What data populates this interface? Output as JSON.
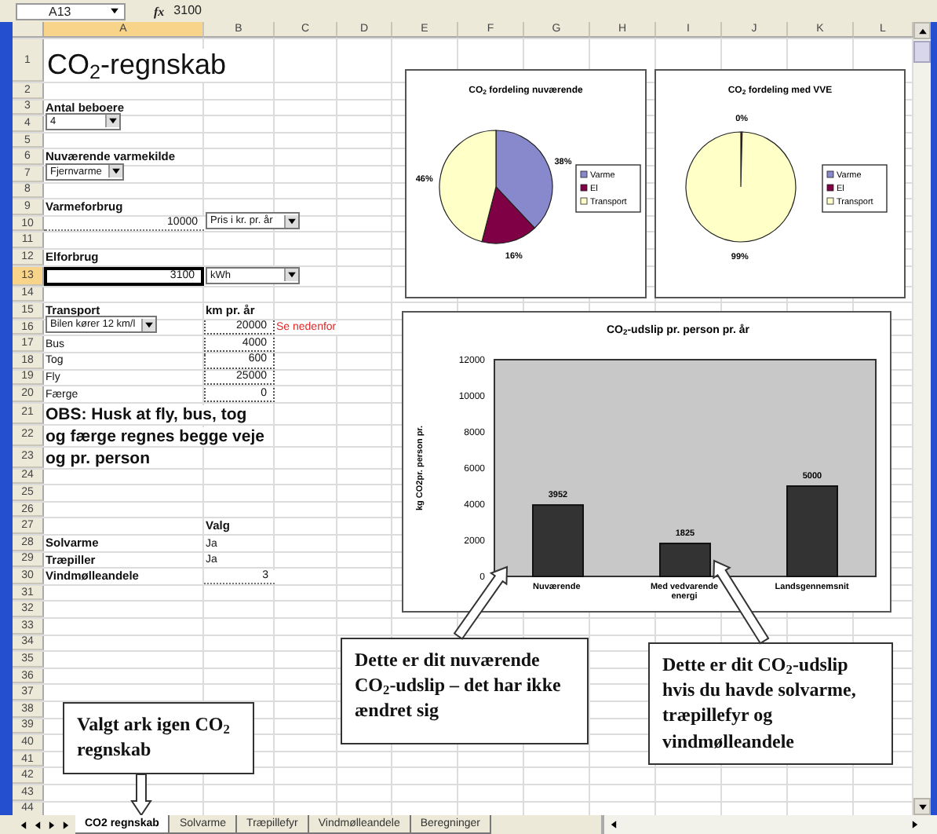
{
  "formula_bar": {
    "name_box": "A13",
    "function_label": "fx",
    "formula": "3100"
  },
  "columns": [
    "A",
    "B",
    "C",
    "D",
    "E",
    "F",
    "G",
    "H",
    "I",
    "J",
    "K",
    "L"
  ],
  "rows": [
    {
      "number": "1",
      "col_a": {
        "text": "CO$_{2}$-regnskab",
        "kind": "title",
        "selected": false
      }
    },
    {
      "number": "2"
    },
    {
      "number": "3",
      "col_a": {
        "text": "Antal beboere",
        "kind": "label",
        "selected": false
      }
    },
    {
      "number": "4",
      "col_a": {
        "text": "4",
        "kind": "dropdown",
        "selected": false
      }
    },
    {
      "number": "5"
    },
    {
      "number": "6",
      "col_a": {
        "text": "Nuværende varmekilde",
        "kind": "label",
        "selected": false
      }
    },
    {
      "number": "7",
      "col_a": {
        "text": "Fjernvarme",
        "kind": "dropdown",
        "selected": false
      }
    },
    {
      "number": "8"
    },
    {
      "number": "9",
      "col_a": {
        "text": "Varmeforbrug",
        "kind": "label",
        "selected": false
      }
    },
    {
      "number": "10",
      "col_a": {
        "text": "10000",
        "kind": "number",
        "selected": false
      },
      "col_b": {
        "text": "Pris i kr. pr. år",
        "kind": "dropdown",
        "selected": false
      }
    },
    {
      "number": "11"
    },
    {
      "number": "12",
      "col_a": {
        "text": "Elforbrug",
        "kind": "label",
        "selected": false
      }
    },
    {
      "number": "13",
      "col_a": {
        "text": "3100",
        "kind": "number",
        "selected": true
      },
      "col_b": {
        "text": "kWh",
        "kind": "dropdown",
        "selected": false
      }
    },
    {
      "number": "14"
    },
    {
      "number": "15",
      "col_a": {
        "text": "Transport",
        "kind": "label",
        "selected": false
      },
      "col_b": {
        "text": "km pr. år",
        "kind": "label",
        "selected": false
      }
    },
    {
      "number": "16",
      "col_a": {
        "text": "Bilen kører 12 km/l",
        "kind": "dropdown",
        "selected": false
      },
      "col_b": {
        "text": "20000",
        "kind": "input",
        "selected": false
      },
      "col_c": {
        "text": "Se nedenfor",
        "kind": "warning",
        "selected": false
      }
    },
    {
      "number": "17",
      "col_a": {
        "text": "Bus",
        "kind": "text",
        "selected": false
      },
      "col_b": {
        "text": "4000",
        "kind": "input",
        "selected": false
      }
    },
    {
      "number": "18",
      "col_a": {
        "text": "Tog",
        "kind": "text",
        "selected": false
      },
      "col_b": {
        "text": "600",
        "kind": "input",
        "selected": false
      }
    },
    {
      "number": "19",
      "col_a": {
        "text": "Fly",
        "kind": "text",
        "selected": false
      },
      "col_b": {
        "text": "25000",
        "kind": "input",
        "selected": false
      }
    },
    {
      "number": "20",
      "col_a": {
        "text": "Færge",
        "kind": "text",
        "selected": false
      },
      "col_b": {
        "text": "0",
        "kind": "input",
        "selected": false
      }
    },
    {
      "number": "21",
      "col_a": {
        "text": "OBS: Husk at fly, bus, tog",
        "kind": "note",
        "selected": false
      }
    },
    {
      "number": "22",
      "col_a": {
        "text": "og færge regnes begge veje",
        "kind": "note",
        "selected": false
      }
    },
    {
      "number": "23",
      "col_a": {
        "text": "og pr. person",
        "kind": "note",
        "selected": false
      }
    },
    {
      "number": "24"
    },
    {
      "number": "25"
    },
    {
      "number": "26"
    },
    {
      "number": "27",
      "col_b": {
        "text": "Valg",
        "kind": "label",
        "selected": false
      }
    },
    {
      "number": "28",
      "col_a": {
        "text": "Solvarme",
        "kind": "label",
        "selected": false
      },
      "col_b": {
        "text": "Ja",
        "kind": "text",
        "selected": false
      }
    },
    {
      "number": "29",
      "col_a": {
        "text": "Træpiller",
        "kind": "label",
        "selected": false
      },
      "col_b": {
        "text": "Ja",
        "kind": "text",
        "selected": false
      }
    },
    {
      "number": "30",
      "col_a": {
        "text": "Vindmølleandele",
        "kind": "label",
        "selected": false
      },
      "col_b": {
        "text": "3",
        "kind": "number",
        "selected": false
      }
    },
    {
      "number": "31"
    },
    {
      "number": "32"
    },
    {
      "number": "33"
    },
    {
      "number": "34"
    },
    {
      "number": "35"
    },
    {
      "number": "36"
    },
    {
      "number": "37"
    },
    {
      "number": "38"
    },
    {
      "number": "39"
    },
    {
      "number": "40"
    },
    {
      "number": "41"
    },
    {
      "number": "42"
    },
    {
      "number": "43"
    },
    {
      "number": "44"
    }
  ],
  "pie_charts": [
    {
      "chart_data": {
        "type": "pie",
        "title": "CO$_{2}$ fordeling nuværende",
        "categories": [
          "Varme",
          "El",
          "Transport"
        ],
        "values": [
          38,
          16,
          46
        ],
        "colors": [
          "#8888cc",
          "#800046",
          "#ffffc8"
        ],
        "data_labels": true,
        "value_labels": [
          "38%",
          "16%",
          "46%"
        ],
        "legend": "right"
      }
    },
    {
      "chart_data": {
        "type": "pie",
        "title": "CO$_{2}$ fordeling med VVE",
        "categories": [
          "Varme",
          "El",
          "Transport"
        ],
        "values": [
          0,
          0.4,
          99.4
        ],
        "colors": [
          "#8888cc",
          "#800046",
          "#ffffc8"
        ],
        "data_labels": true,
        "value_labels": [
          null,
          "0%",
          "99%"
        ],
        "legend": "right"
      }
    }
  ],
  "bar_chart": {
    "chart_data": {
      "type": "bar",
      "title": "CO$_{2}$-udslip pr. person pr. år",
      "ylabel": "kg CO2pr. person pr.",
      "categories": [
        "Nuværende",
        "Med vedvarende energi",
        "Landsgennemsnit"
      ],
      "values": [
        3952,
        1825,
        5000
      ],
      "ylim": [
        0,
        12000
      ],
      "yticks": [
        0,
        2000,
        4000,
        6000,
        8000,
        10000,
        12000
      ],
      "data_labels": true
    }
  },
  "callouts": [
    {
      "text": "Dette er dit nuværende CO$_{2}$-udslip – det har ikke ændret sig"
    },
    {
      "text": "Dette er dit CO$_{2}$-udslip hvis du havde solvarme, træpillefyr og vindmølleandele"
    },
    {
      "text": "Valgt ark igen CO$_{2}$ regnskab"
    }
  ],
  "sheet_tabs": [
    {
      "label": "CO2 regnskab",
      "selected": true
    },
    {
      "label": "Solvarme",
      "selected": false
    },
    {
      "label": "Træpillefyr",
      "selected": false
    },
    {
      "label": "Vindmølleandele",
      "selected": false
    },
    {
      "label": "Beregninger",
      "selected": false
    }
  ]
}
